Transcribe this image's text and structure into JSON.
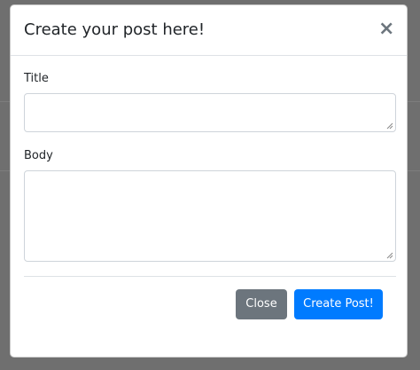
{
  "modal": {
    "title": "Create your post here!",
    "close_icon": "close-icon",
    "close_glyph": "×"
  },
  "form": {
    "title_label": "Title",
    "title_value": "",
    "body_label": "Body",
    "body_value": ""
  },
  "footer": {
    "close_label": "Close",
    "submit_label": "Create Post!"
  },
  "colors": {
    "primary": "#007bff",
    "secondary": "#6c757d",
    "backdrop": "#6f6f6f"
  }
}
